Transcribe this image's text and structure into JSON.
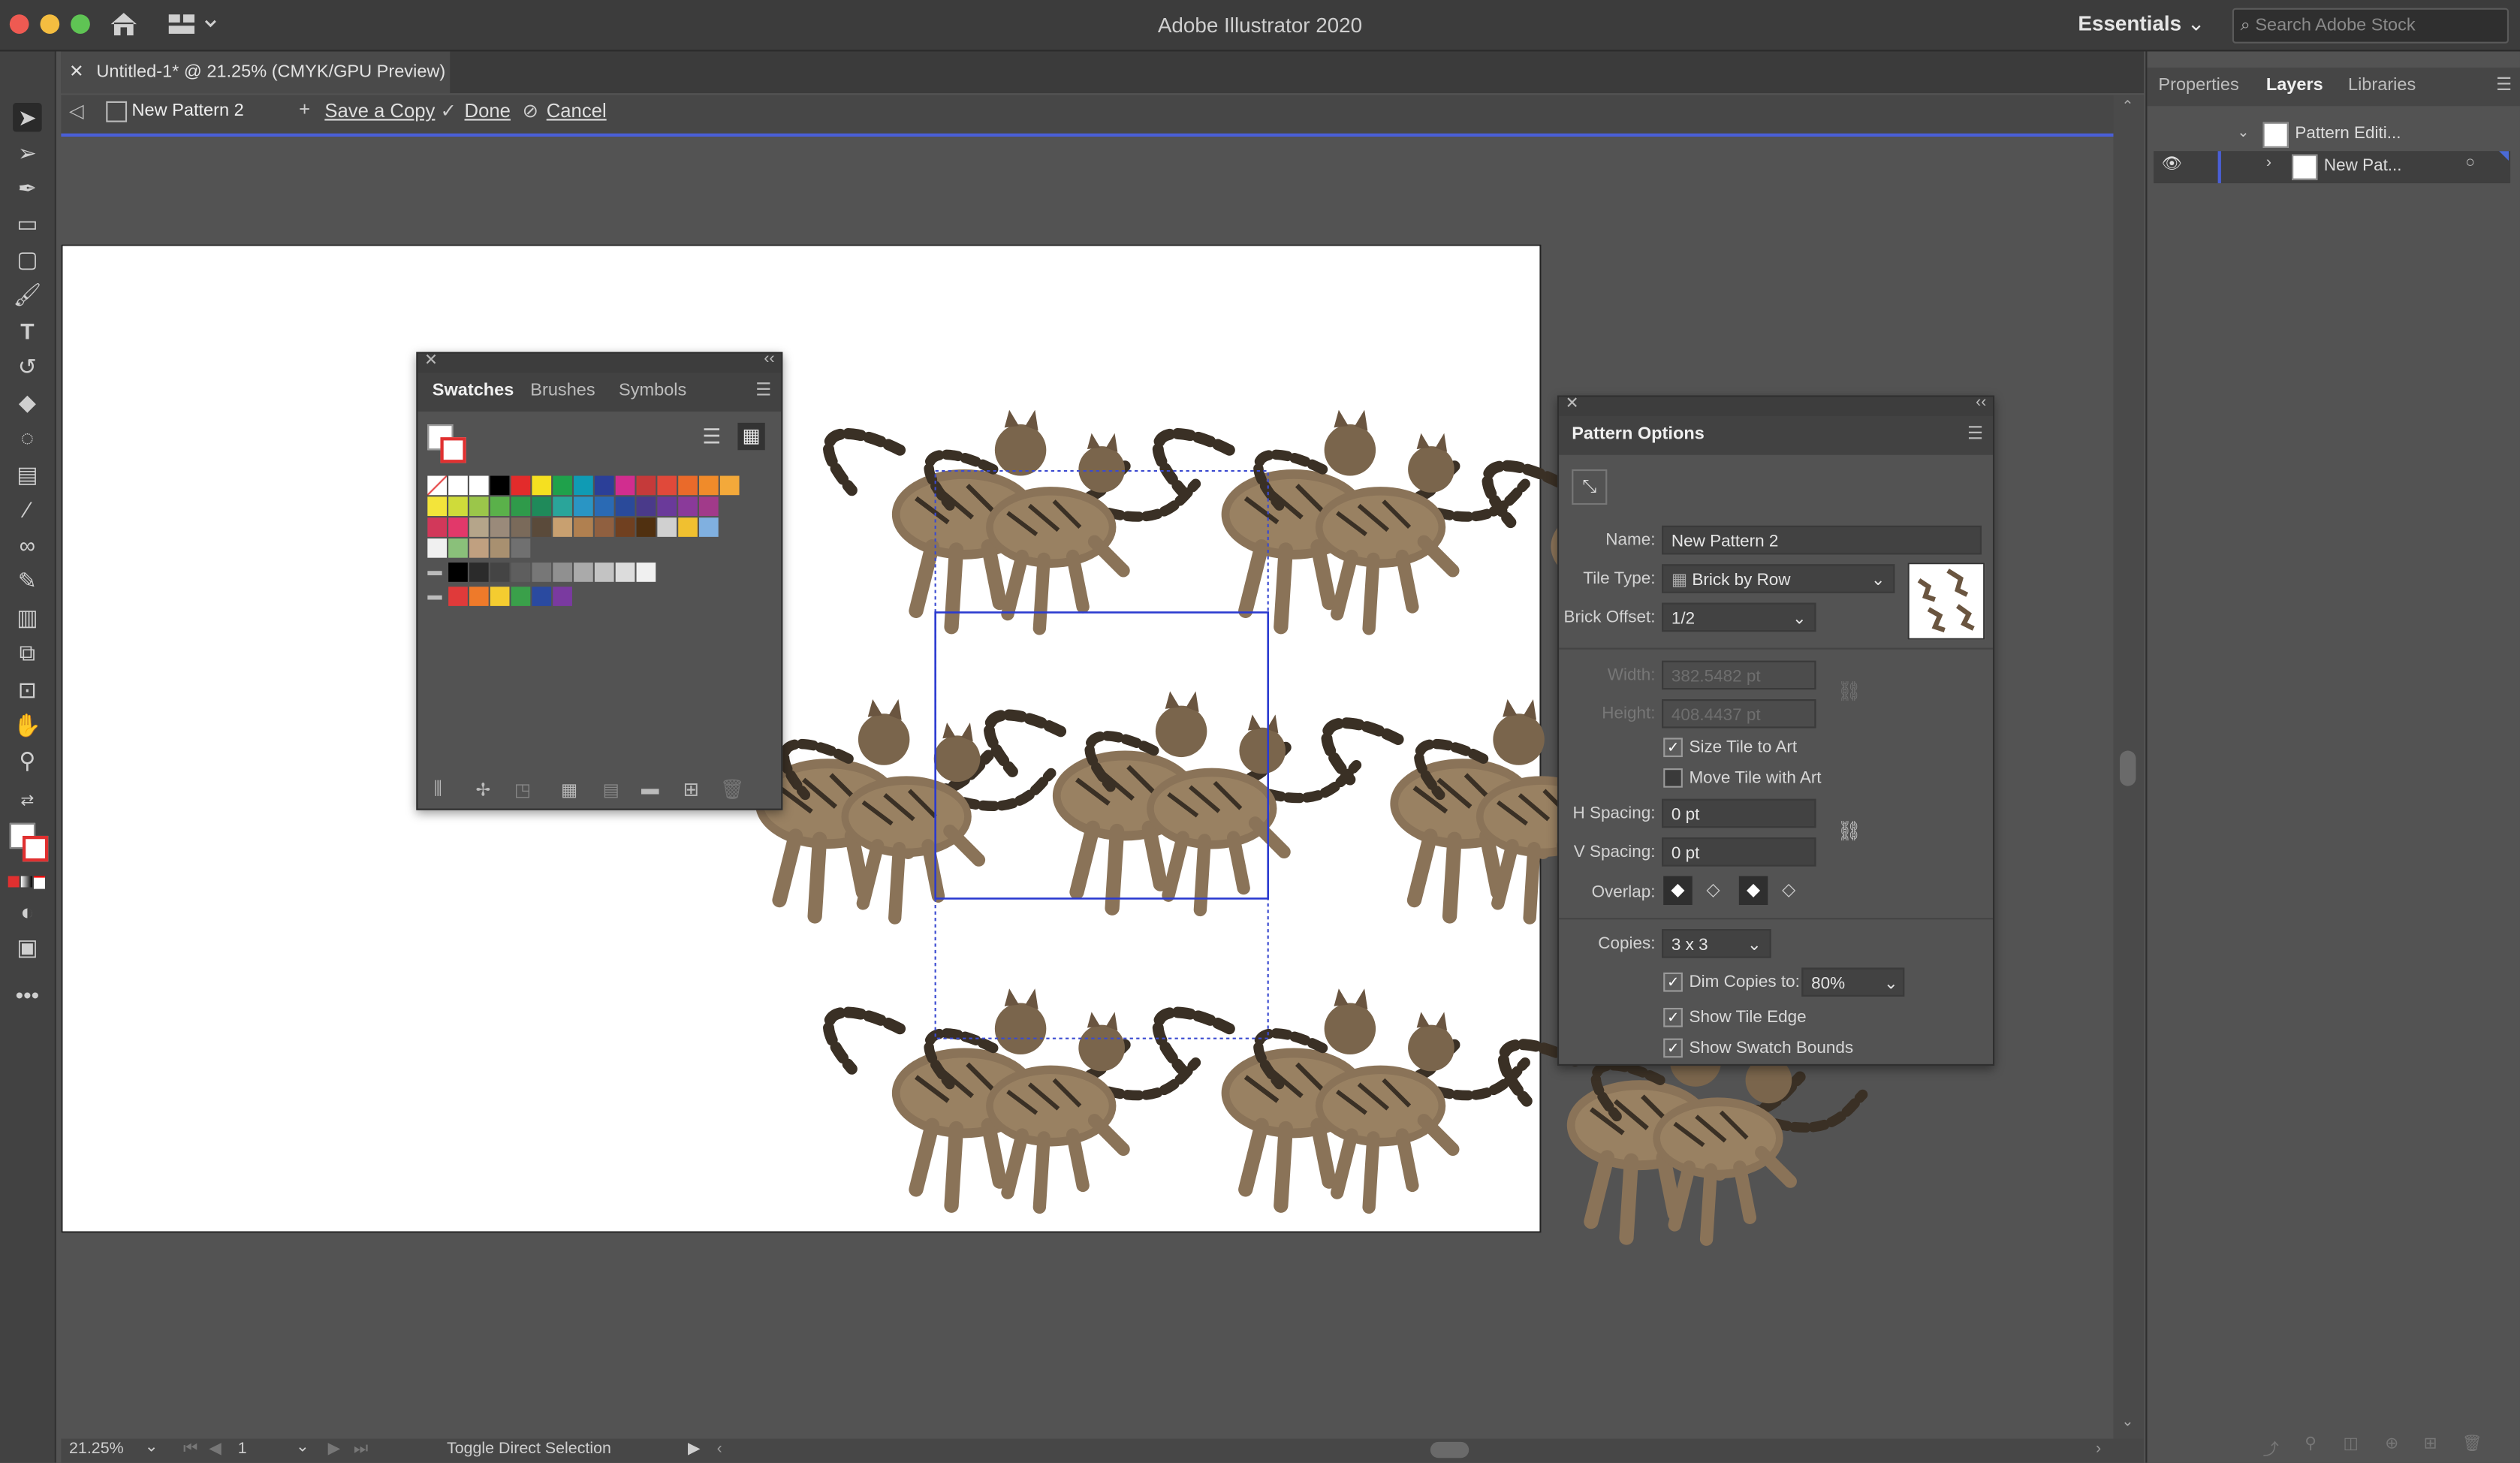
{
  "window": {
    "app_title": "Adobe Illustrator 2020",
    "workspace": "Essentials",
    "stock_placeholder": "Search Adobe Stock"
  },
  "document": {
    "tab_title": "Untitled-1* @ 21.25% (CMYK/GPU Preview)"
  },
  "pattern_bar": {
    "pattern_name": "New Pattern 2",
    "save_copy": "Save a Copy",
    "done": "Done",
    "cancel": "Cancel"
  },
  "swatches_panel": {
    "tabs": [
      "Swatches",
      "Brushes",
      "Symbols"
    ],
    "active_tab": "Swatches",
    "rows": [
      [
        "#ffffff",
        "#ffffff",
        "#ffffff",
        "#000000",
        "#e32b2b",
        "#f5e020",
        "#1fa14b",
        "#0f9bb4",
        "#2b3f98",
        "#d12d8f",
        "#c53a3a",
        "#e0493a",
        "#ea6a2a",
        "#f08b2a",
        "#f3a93a"
      ],
      [
        "#f3e43a",
        "#cfdb3a",
        "#9bc64a",
        "#5ab14a",
        "#2f9a4a",
        "#1f8a5a",
        "#2aa59a",
        "#2a95c4",
        "#2a6ab4",
        "#2a4a9a",
        "#4a3a8a",
        "#6a3a9a",
        "#8a3a9a",
        "#a13a8a"
      ],
      [
        "#d2385a",
        "#e2386a",
        "#b5a58a",
        "#9a8a7a",
        "#7a6a5a",
        "#5a4a3a",
        "#c8a070",
        "#b08050",
        "#906040",
        "#704020",
        "#503010",
        "#d0d0d0",
        "#f0c030",
        "#80b0e0"
      ],
      [
        "#f0f0f0",
        "#8ac07a",
        "#c0a080",
        "#a89070",
        "#707070"
      ],
      [
        "#000000",
        "#2b2b2b",
        "#444444",
        "#5e5e5e",
        "#777777",
        "#909090",
        "#aaaaaa",
        "#c3c3c3",
        "#dcdcdc",
        "#f0f0f0"
      ],
      [
        "#e03a3a",
        "#ee7a2a",
        "#f4cc30",
        "#3aa04a",
        "#2a4aa0",
        "#7a3aa0"
      ]
    ]
  },
  "pattern_options": {
    "title": "Pattern Options",
    "name_label": "Name:",
    "name_value": "New Pattern 2",
    "tile_type_label": "Tile Type:",
    "tile_type_value": "Brick by Row",
    "brick_offset_label": "Brick Offset:",
    "brick_offset_value": "1/2",
    "width_label": "Width:",
    "width_value": "382.5482 pt",
    "height_label": "Height:",
    "height_value": "408.4437 pt",
    "size_tile_label": "Size Tile to Art",
    "size_tile_checked": true,
    "move_tile_label": "Move Tile with Art",
    "move_tile_checked": false,
    "h_spacing_label": "H Spacing:",
    "h_spacing_value": "0 pt",
    "v_spacing_label": "V Spacing:",
    "v_spacing_value": "0 pt",
    "overlap_label": "Overlap:",
    "copies_label": "Copies:",
    "copies_value": "3 x 3",
    "dim_copies_label": "Dim Copies to:",
    "dim_copies_value": "80%",
    "show_tile_edge_label": "Show Tile Edge",
    "show_swatch_bounds_label": "Show Swatch Bounds"
  },
  "right_dock": {
    "tabs": [
      "Properties",
      "Layers",
      "Libraries"
    ],
    "active_tab": "Layers",
    "layers": [
      {
        "name": "Pattern Editi..."
      },
      {
        "name": "New Pat..."
      }
    ]
  },
  "status_bar": {
    "zoom": "21.25%",
    "artboard": "1",
    "status_text": "Toggle Direct Selection"
  },
  "icons": {
    "home": "home-icon",
    "selection": "selection-tool-icon",
    "eye": "eye-icon"
  }
}
